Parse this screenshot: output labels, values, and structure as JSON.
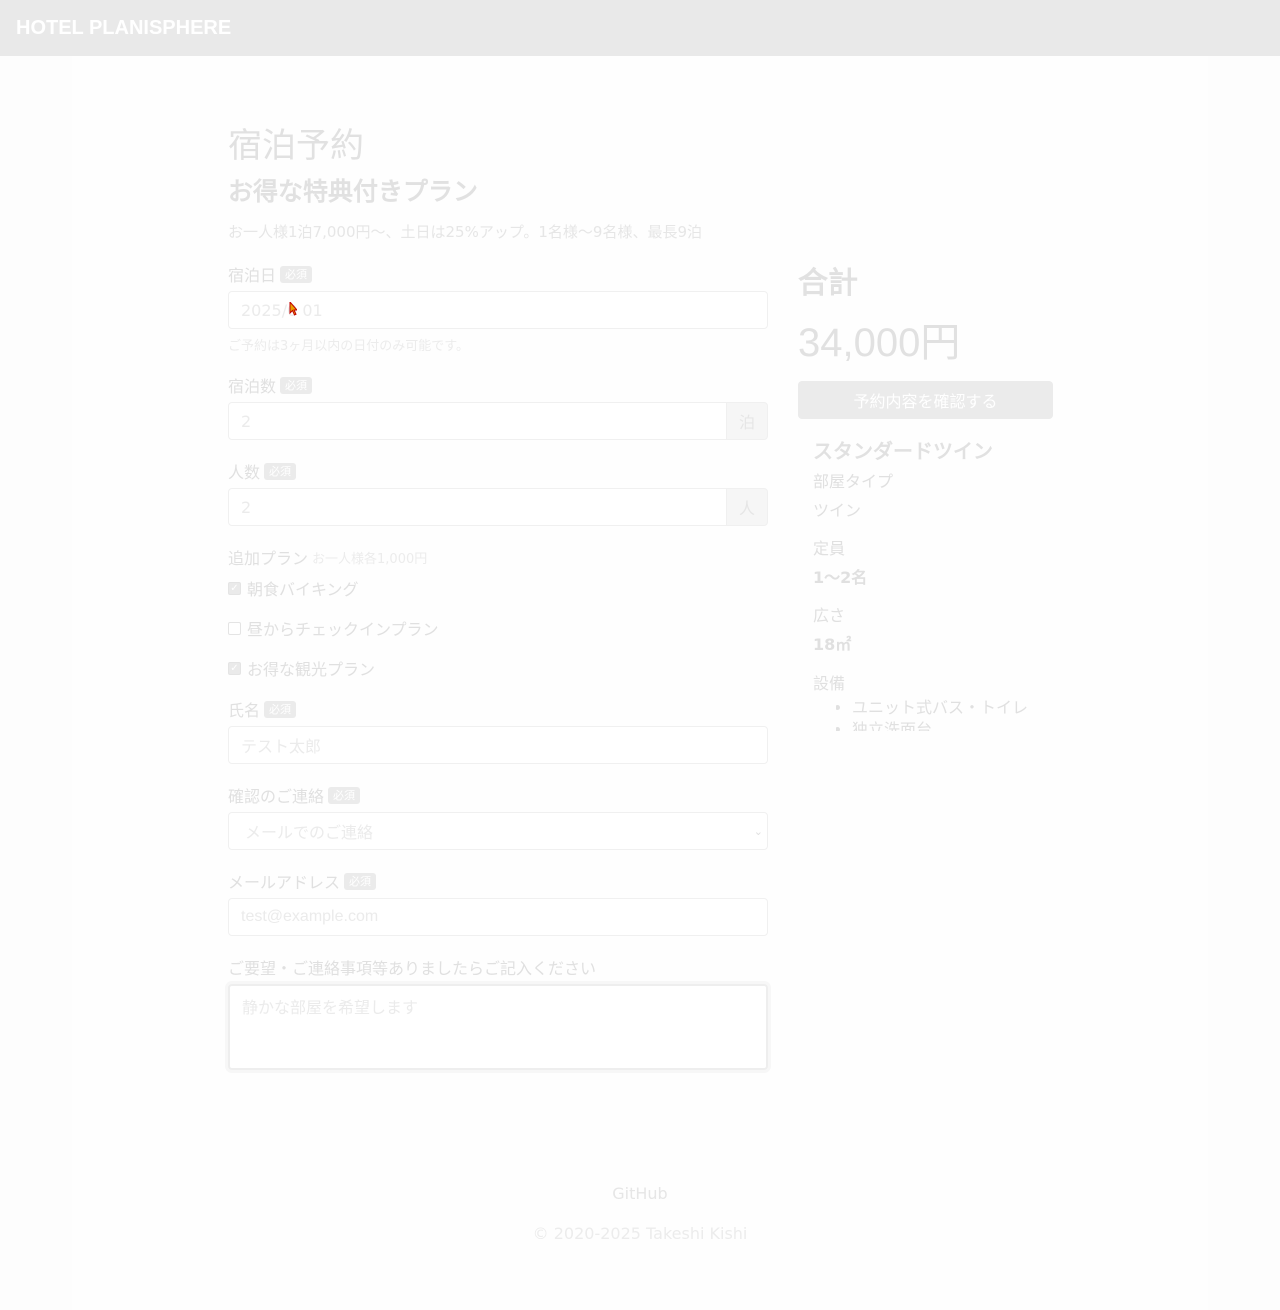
{
  "navbar": {
    "brand": "HOTEL PLANISPHERE"
  },
  "header": {
    "title": "宿泊予約",
    "plan_name": "お得な特典付きプラン",
    "plan_desc": "お一人様1泊7,000円〜、土日は25%アップ。1名様〜9名様、最長9泊"
  },
  "form": {
    "required_badge": "必須",
    "date": {
      "label": "宿泊日",
      "value": "2025/0 01",
      "help": "ご予約は3ヶ月以内の日付のみ可能です。"
    },
    "term": {
      "label": "宿泊数",
      "value": "2",
      "unit": "泊"
    },
    "head_count": {
      "label": "人数",
      "value": "2",
      "unit": "人"
    },
    "additional_plans": {
      "label": "追加プラン",
      "note": "お一人様各1,000円",
      "options": [
        {
          "label": "朝食バイキング",
          "checked": true
        },
        {
          "label": "昼からチェックインプラン",
          "checked": false
        },
        {
          "label": "お得な観光プラン",
          "checked": true
        }
      ]
    },
    "name": {
      "label": "氏名",
      "value": "テスト太郎"
    },
    "contact": {
      "label": "確認のご連絡",
      "value": "メールでのご連絡"
    },
    "email": {
      "label": "メールアドレス",
      "value": "test@example.com"
    },
    "comment": {
      "label": "ご要望・ご連絡事項等ありましたらご記入ください",
      "value": "静かな部屋を希望します"
    }
  },
  "summary": {
    "total_label": "合計",
    "total_value": "34,000円",
    "confirm_button": "予約内容を確認する"
  },
  "room": {
    "name": "スタンダードツイン",
    "type_label": "部屋タイプ",
    "type_value": "ツイン",
    "capacity_label": "定員",
    "capacity_value": "1〜2名",
    "size_label": "広さ",
    "size_value": "18㎡",
    "facilities_label": "設備",
    "facilities": [
      "ユニット式バス・トイレ",
      "独立洗面台"
    ]
  },
  "footer": {
    "link": "GitHub",
    "copyright": "© 2020-2025 Takeshi Kishi"
  },
  "icons": {
    "checkmark": "✓",
    "select_arrow": "⌄"
  }
}
